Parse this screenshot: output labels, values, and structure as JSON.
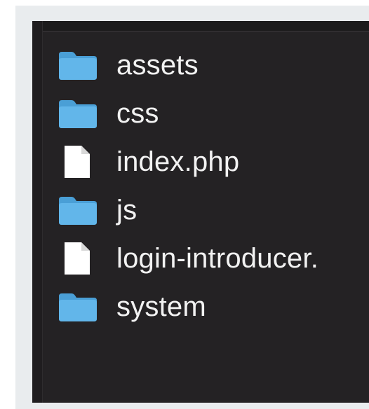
{
  "file_list": {
    "items": [
      {
        "name": "assets",
        "type": "folder",
        "icon": "folder-icon"
      },
      {
        "name": "css",
        "type": "folder",
        "icon": "folder-icon"
      },
      {
        "name": "index.php",
        "type": "file",
        "icon": "document-icon"
      },
      {
        "name": "js",
        "type": "folder",
        "icon": "folder-icon"
      },
      {
        "name": "login-introducer.",
        "type": "file",
        "icon": "document-icon"
      },
      {
        "name": "system",
        "type": "folder",
        "icon": "folder-icon"
      }
    ]
  },
  "colors": {
    "pane_background": "#242224",
    "outer_background": "#e9ecee",
    "folder_blue": "#5fb3e6",
    "text": "#f2f2f2"
  }
}
